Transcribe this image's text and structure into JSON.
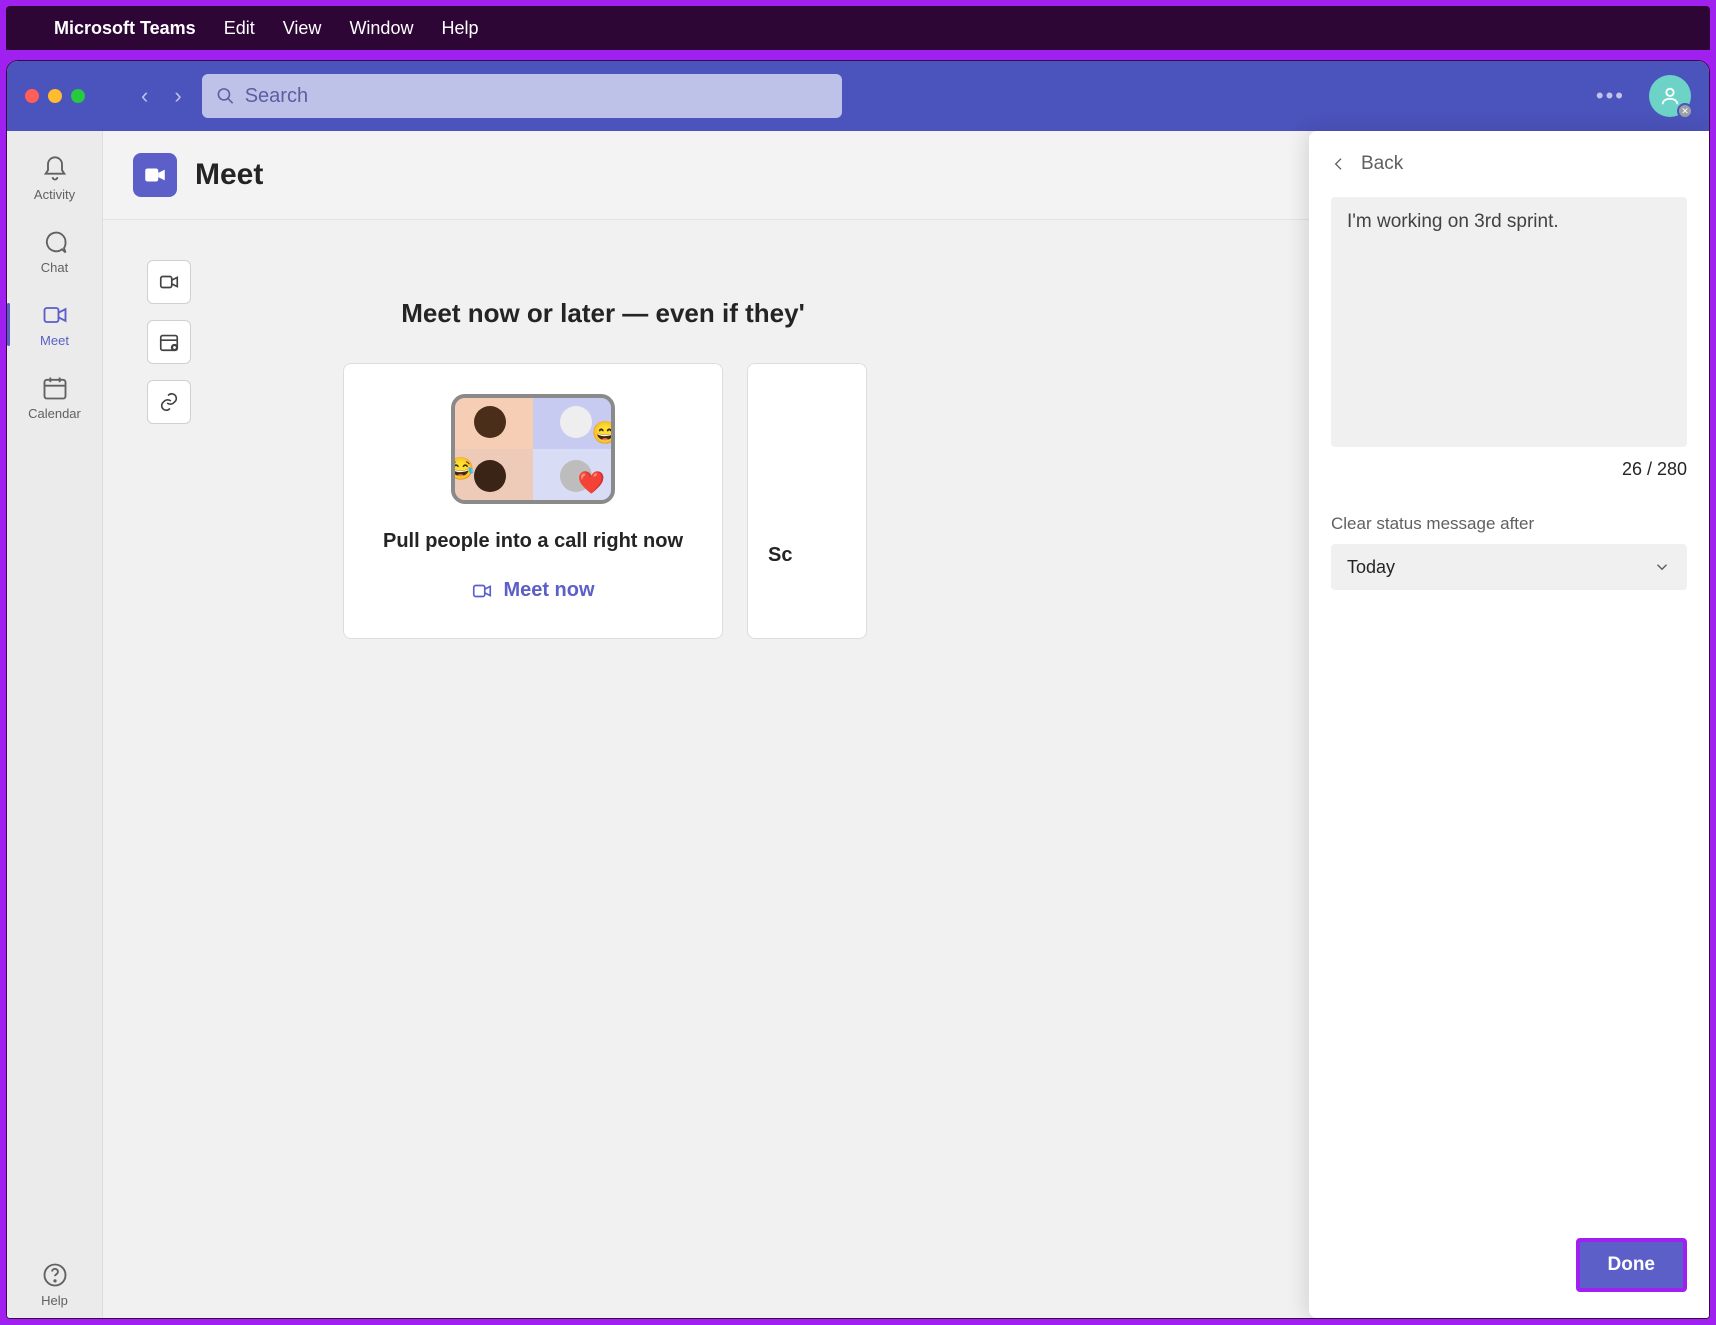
{
  "menubar": {
    "app": "Microsoft Teams",
    "items": [
      "Edit",
      "View",
      "Window",
      "Help"
    ]
  },
  "search": {
    "placeholder": "Search"
  },
  "rail": {
    "activity": "Activity",
    "chat": "Chat",
    "meet": "Meet",
    "calendar": "Calendar",
    "help": "Help"
  },
  "page": {
    "title": "Meet",
    "hero": "Meet now or later — even if they'",
    "card1": {
      "title": "Pull people into a call right now",
      "button": "Meet now"
    },
    "card2": {
      "peek": "Sc"
    }
  },
  "panel": {
    "back": "Back",
    "status_text": "I'm working on 3rd sprint.",
    "counter": "26 / 280",
    "clear_label": "Clear status message after",
    "clear_value": "Today",
    "done": "Done"
  }
}
